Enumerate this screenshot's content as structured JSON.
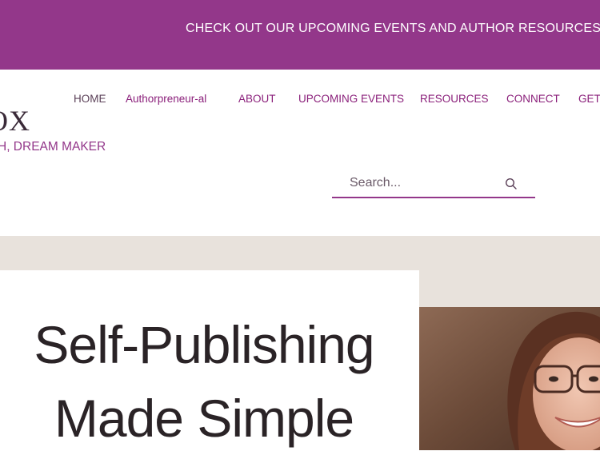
{
  "banner": {
    "text": "CHECK OUT OUR UPCOMING EVENTS AND AUTHOR RESOURCES."
  },
  "header": {
    "logo_text": "OX",
    "tagline": "H, DREAM MAKER"
  },
  "nav": {
    "items": [
      {
        "label": "HOME",
        "active": true
      },
      {
        "label": "Authorpreneur-al",
        "active": false
      },
      {
        "label": "ABOUT",
        "active": false
      },
      {
        "label": "UPCOMING EVENTS",
        "active": false
      },
      {
        "label": "RESOURCES",
        "active": false
      },
      {
        "label": "CONNECT",
        "active": false
      },
      {
        "label": "GET",
        "active": false
      }
    ]
  },
  "search": {
    "placeholder": "Search...",
    "value": "",
    "icon": "search-icon"
  },
  "hero": {
    "title_line1": "Self-Publishing",
    "title_line2": "Made Simple"
  },
  "colors": {
    "brand": "#93378a",
    "nav_text": "#8a1f7a",
    "hero_band": "#e8e2dc",
    "title_text": "#2a2326"
  }
}
